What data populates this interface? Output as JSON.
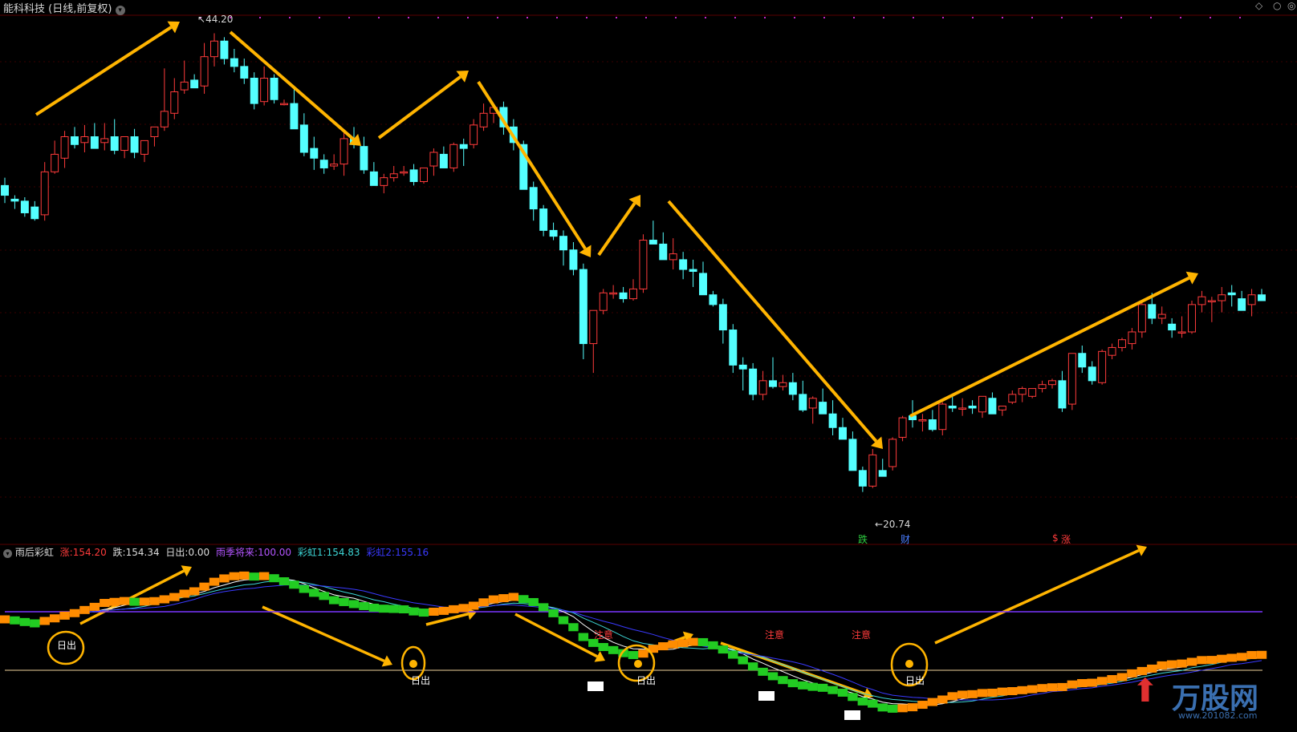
{
  "header": {
    "title": "能科科技",
    "mode": "(日线,前复权)"
  },
  "price_labels": {
    "high": "44.20",
    "low": "20.74"
  },
  "markers": [
    {
      "text": "跌",
      "color": "#2ecc40"
    },
    {
      "text": "财",
      "color": "#4a7dff"
    },
    {
      "text": "$",
      "color": "#ff3b3b"
    },
    {
      "text": "涨",
      "color": "#ff3b3b"
    }
  ],
  "indicator": {
    "name": "雨后彩虹",
    "items": [
      {
        "label": "涨:",
        "value": "154.20",
        "color": "#ff3b3b"
      },
      {
        "label": "跌:",
        "value": "154.34",
        "color": "#dddddd"
      },
      {
        "label": "日出:",
        "value": "0.00",
        "color": "#dddddd"
      },
      {
        "label": "雨季将来:",
        "value": "100.00",
        "color": "#b455ff"
      },
      {
        "label": "彩虹1:",
        "value": "154.83",
        "color": "#3dd6d6"
      },
      {
        "label": "彩虹2:",
        "value": "155.16",
        "color": "#3a3aff"
      }
    ],
    "notes": [
      "注意",
      "注意",
      "注意"
    ],
    "sunrise_label": "日出"
  },
  "watermark": {
    "brand": "万股网",
    "url": "www.201082.com"
  },
  "colors": {
    "up": "#ff3b3b",
    "down": "#54ffff",
    "arrow": "#ffb400",
    "green": "#22cc22",
    "orange": "#ff8c00",
    "purple": "#7a35ff",
    "cream": "#f0d39b"
  },
  "chart_data": {
    "type": "candlestick",
    "ylim": [
      19,
      45
    ],
    "high_label": 44.2,
    "low_label": 20.74,
    "candles": [
      [
        36.4,
        36.8,
        35.5,
        35.9
      ],
      [
        35.7,
        35.9,
        35.2,
        35.6
      ],
      [
        35.6,
        35.8,
        34.8,
        35.0
      ],
      [
        35.3,
        35.6,
        34.6,
        34.7
      ],
      [
        34.9,
        37.6,
        34.6,
        37.1
      ],
      [
        37.1,
        38.7,
        37.0,
        38.0
      ],
      [
        37.8,
        39.2,
        37.3,
        38.9
      ],
      [
        38.9,
        39.4,
        38.3,
        38.5
      ],
      [
        38.6,
        39.5,
        38.1,
        38.9
      ],
      [
        38.9,
        39.6,
        38.4,
        38.3
      ],
      [
        38.6,
        39.6,
        38.2,
        38.8
      ],
      [
        38.9,
        39.8,
        38.0,
        38.2
      ],
      [
        38.2,
        38.9,
        37.8,
        38.9
      ],
      [
        38.9,
        39.3,
        37.8,
        38.1
      ],
      [
        38.0,
        38.6,
        37.6,
        38.7
      ],
      [
        38.9,
        39.3,
        38.4,
        39.4
      ],
      [
        39.4,
        42.4,
        39.2,
        40.2
      ],
      [
        40.1,
        41.9,
        39.8,
        41.2
      ],
      [
        41.3,
        42.8,
        41.1,
        41.7
      ],
      [
        41.8,
        42.1,
        41.4,
        41.4
      ],
      [
        41.5,
        43.7,
        41.1,
        43.0
      ],
      [
        43.0,
        44.2,
        42.5,
        43.8
      ],
      [
        43.8,
        44.0,
        42.6,
        42.9
      ],
      [
        42.9,
        43.4,
        42.2,
        42.5
      ],
      [
        42.5,
        42.9,
        41.6,
        41.9
      ],
      [
        41.9,
        42.2,
        40.3,
        40.6
      ],
      [
        40.7,
        42.5,
        40.5,
        41.9
      ],
      [
        41.9,
        42.1,
        40.6,
        40.8
      ],
      [
        40.6,
        40.8,
        40.5,
        40.6
      ],
      [
        40.6,
        41.4,
        39.4,
        39.3
      ],
      [
        39.5,
        40.1,
        37.9,
        38.1
      ],
      [
        38.3,
        38.9,
        37.2,
        37.8
      ],
      [
        37.7,
        38.0,
        37.0,
        37.3
      ],
      [
        37.4,
        38.0,
        37.2,
        37.5
      ],
      [
        37.5,
        39.1,
        36.9,
        38.8
      ],
      [
        38.8,
        39.4,
        38.3,
        38.5
      ],
      [
        38.4,
        38.9,
        37.0,
        37.2
      ],
      [
        37.1,
        37.6,
        36.4,
        36.4
      ],
      [
        36.4,
        37.0,
        36.0,
        36.8
      ],
      [
        36.8,
        37.4,
        36.6,
        37.0
      ],
      [
        37.1,
        37.4,
        36.9,
        37.1
      ],
      [
        37.2,
        37.5,
        36.4,
        36.6
      ],
      [
        36.6,
        37.2,
        36.5,
        37.3
      ],
      [
        37.4,
        38.3,
        36.9,
        38.1
      ],
      [
        38.0,
        38.4,
        37.5,
        37.3
      ],
      [
        37.3,
        38.6,
        37.1,
        38.5
      ],
      [
        38.5,
        38.8,
        37.4,
        38.3
      ],
      [
        38.5,
        39.8,
        38.3,
        39.5
      ],
      [
        39.4,
        40.6,
        39.2,
        40.1
      ],
      [
        40.1,
        40.6,
        39.6,
        40.4
      ],
      [
        40.4,
        40.7,
        39.0,
        39.4
      ],
      [
        39.4,
        39.8,
        38.2,
        38.6
      ],
      [
        38.5,
        38.7,
        36.3,
        36.2
      ],
      [
        36.3,
        36.6,
        34.6,
        35.2
      ],
      [
        35.2,
        35.4,
        33.8,
        34.1
      ],
      [
        34.1,
        34.5,
        33.6,
        33.8
      ],
      [
        33.8,
        34.1,
        32.3,
        33.1
      ],
      [
        33.1,
        33.5,
        31.8,
        32.1
      ],
      [
        32.1,
        32.4,
        27.5,
        28.3
      ],
      [
        28.3,
        28.9,
        26.8,
        30.0
      ],
      [
        30.0,
        31.1,
        29.8,
        30.9
      ],
      [
        30.9,
        31.3,
        30.6,
        30.9
      ],
      [
        30.9,
        31.2,
        30.4,
        30.6
      ],
      [
        30.6,
        31.6,
        30.5,
        31.1
      ],
      [
        31.1,
        33.9,
        30.9,
        33.6
      ],
      [
        33.6,
        34.6,
        33.4,
        33.4
      ],
      [
        33.4,
        34.0,
        32.8,
        32.6
      ],
      [
        32.6,
        33.7,
        32.1,
        32.9
      ],
      [
        32.6,
        33.0,
        31.6,
        32.1
      ],
      [
        32.1,
        32.6,
        31.2,
        32.0
      ],
      [
        31.9,
        32.5,
        31.5,
        30.8
      ],
      [
        30.8,
        31.0,
        30.2,
        30.3
      ],
      [
        30.3,
        30.6,
        28.3,
        29.0
      ],
      [
        29.0,
        29.3,
        26.8,
        27.2
      ],
      [
        27.2,
        27.6,
        25.9,
        27.0
      ],
      [
        27.0,
        27.3,
        25.4,
        25.7
      ],
      [
        25.7,
        26.9,
        25.4,
        26.4
      ],
      [
        26.4,
        27.6,
        26.0,
        26.1
      ],
      [
        26.1,
        26.7,
        25.9,
        26.3
      ],
      [
        26.3,
        26.8,
        25.4,
        25.7
      ],
      [
        25.7,
        26.4,
        24.8,
        24.9
      ],
      [
        25.0,
        25.6,
        24.2,
        25.5
      ],
      [
        25.3,
        26.0,
        24.8,
        24.7
      ],
      [
        24.7,
        25.4,
        23.6,
        24.0
      ],
      [
        24.0,
        24.5,
        23.4,
        23.4
      ],
      [
        23.4,
        23.8,
        22.0,
        21.8
      ],
      [
        21.8,
        22.0,
        20.7,
        21.0
      ],
      [
        21.0,
        22.9,
        20.9,
        22.6
      ],
      [
        21.8,
        22.4,
        21.5,
        21.5
      ],
      [
        22.0,
        23.5,
        21.8,
        23.4
      ],
      [
        23.5,
        24.6,
        23.3,
        24.5
      ],
      [
        24.6,
        25.4,
        24.0,
        24.4
      ],
      [
        24.4,
        24.7,
        23.8,
        24.4
      ],
      [
        24.4,
        24.9,
        23.8,
        23.9
      ],
      [
        23.9,
        25.3,
        23.6,
        25.2
      ],
      [
        25.1,
        25.6,
        24.8,
        25.0
      ],
      [
        25.0,
        25.5,
        24.6,
        25.0
      ],
      [
        25.1,
        25.4,
        24.7,
        25.0
      ],
      [
        24.8,
        25.6,
        24.5,
        25.6
      ],
      [
        25.5,
        25.8,
        24.7,
        24.7
      ],
      [
        24.9,
        25.1,
        24.6,
        25.1
      ],
      [
        25.3,
        25.9,
        25.2,
        25.7
      ],
      [
        25.7,
        26.1,
        25.3,
        26.0
      ],
      [
        25.6,
        25.9,
        25.5,
        26.0
      ],
      [
        26.0,
        26.4,
        25.8,
        26.2
      ],
      [
        26.2,
        26.5,
        26.0,
        26.4
      ],
      [
        26.4,
        26.9,
        24.8,
        25.0
      ],
      [
        25.2,
        27.8,
        24.9,
        27.8
      ],
      [
        27.8,
        28.2,
        26.8,
        27.1
      ],
      [
        27.1,
        27.4,
        26.2,
        26.4
      ],
      [
        26.3,
        28.0,
        26.2,
        27.9
      ],
      [
        27.7,
        28.3,
        27.5,
        28.1
      ],
      [
        28.1,
        28.6,
        27.9,
        28.5
      ],
      [
        28.3,
        29.1,
        28.0,
        28.9
      ],
      [
        28.9,
        30.5,
        28.6,
        30.3
      ],
      [
        30.3,
        30.9,
        29.3,
        29.6
      ],
      [
        29.6,
        30.2,
        29.3,
        29.8
      ],
      [
        29.3,
        29.6,
        28.6,
        29.0
      ],
      [
        28.9,
        29.7,
        28.6,
        28.9
      ],
      [
        28.9,
        30.5,
        28.8,
        30.3
      ],
      [
        30.3,
        31.0,
        29.9,
        30.7
      ],
      [
        30.5,
        30.7,
        29.4,
        30.5
      ],
      [
        30.5,
        31.2,
        29.9,
        30.8
      ],
      [
        30.9,
        31.3,
        30.2,
        30.8
      ],
      [
        30.6,
        31.0,
        30.0,
        30.0
      ],
      [
        30.3,
        31.1,
        29.7,
        30.8
      ],
      [
        30.8,
        31.1,
        30.5,
        30.5
      ]
    ]
  }
}
